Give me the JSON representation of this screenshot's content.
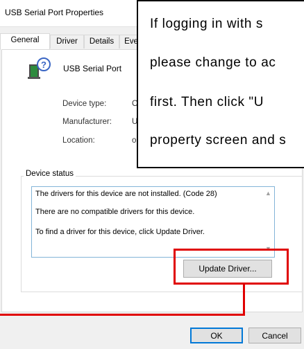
{
  "window": {
    "title": "USB Serial Port Properties"
  },
  "tabs": [
    {
      "label": "General",
      "active": true
    },
    {
      "label": "Driver",
      "active": false
    },
    {
      "label": "Details",
      "active": false
    },
    {
      "label": "Eve",
      "active": false
    }
  ],
  "device": {
    "icon": "usb-serial-device-warning-icon",
    "name": "USB Serial Port",
    "properties": [
      {
        "label": "Device type:",
        "value": "O"
      },
      {
        "label": "Manufacturer:",
        "value": "U"
      },
      {
        "label": "Location:",
        "value": "o"
      }
    ]
  },
  "device_status": {
    "label": "Device status",
    "lines": [
      "The drivers for this device are not installed. (Code 28)",
      "There are no compatible drivers for this device.",
      "To find a driver for this device, click Update Driver."
    ]
  },
  "buttons": {
    "update_driver": "Update Driver...",
    "ok": "OK",
    "cancel": "Cancel"
  },
  "callout": {
    "lines": [
      "If  logging  in  with  s",
      "please  change  to  ac",
      "first.  Then  click  \"U",
      "property screen and s"
    ]
  },
  "colors": {
    "annotation_red": "#e00000",
    "focus_blue": "#0078d7"
  }
}
